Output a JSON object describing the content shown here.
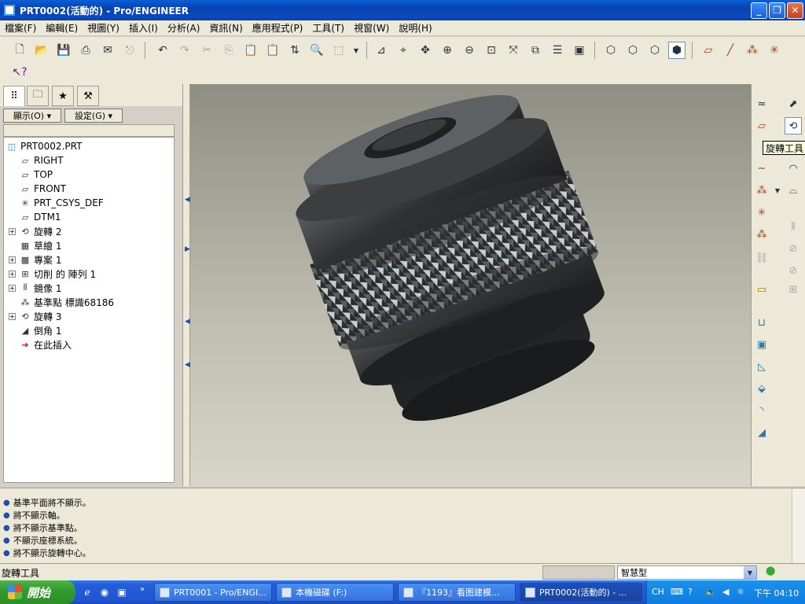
{
  "window": {
    "title": "PRT0002(活動的) - Pro/ENGINEER"
  },
  "menu": [
    "檔案(F)",
    "編輯(E)",
    "視圖(Y)",
    "插入(I)",
    "分析(A)",
    "資訊(N)",
    "應用程式(P)",
    "工具(T)",
    "視窗(W)",
    "說明(H)"
  ],
  "left_panel": {
    "show_button": "顯示(O) ▾",
    "settings_button": "設定(G) ▾",
    "tree": [
      {
        "label": "PRT0002.PRT",
        "icon": "part-icon",
        "glyph": "◫",
        "expand": false,
        "indent": 0
      },
      {
        "label": "RIGHT",
        "icon": "datum-plane-icon",
        "glyph": "▱",
        "expand": false,
        "indent": 1
      },
      {
        "label": "TOP",
        "icon": "datum-plane-icon",
        "glyph": "▱",
        "expand": false,
        "indent": 1
      },
      {
        "label": "FRONT",
        "icon": "datum-plane-icon",
        "glyph": "▱",
        "expand": false,
        "indent": 1
      },
      {
        "label": "PRT_CSYS_DEF",
        "icon": "csys-icon",
        "glyph": "✳",
        "expand": false,
        "indent": 1
      },
      {
        "label": "DTM1",
        "icon": "datum-plane-icon",
        "glyph": "▱",
        "expand": false,
        "indent": 1
      },
      {
        "label": "旋轉 2",
        "icon": "revolve-icon",
        "glyph": "⟲",
        "expand": true,
        "indent": 1
      },
      {
        "label": "草繪 1",
        "icon": "sketch-icon",
        "glyph": "▦",
        "expand": false,
        "indent": 1
      },
      {
        "label": "專案 1",
        "icon": "project-icon",
        "glyph": "▩",
        "expand": true,
        "indent": 1
      },
      {
        "label": "切削 的 陣列 1",
        "icon": "pattern-icon",
        "glyph": "⊞",
        "expand": true,
        "indent": 1
      },
      {
        "label": "鏡像 1",
        "icon": "mirror-icon",
        "glyph": "⫴",
        "expand": true,
        "indent": 1
      },
      {
        "label": "基準點 標識68186",
        "icon": "datum-point-icon",
        "glyph": "⁂",
        "expand": false,
        "indent": 1
      },
      {
        "label": "旋轉 3",
        "icon": "revolve-icon",
        "glyph": "⟲",
        "expand": true,
        "indent": 1
      },
      {
        "label": "倒角 1",
        "icon": "chamfer-icon",
        "glyph": "◢",
        "expand": false,
        "indent": 1
      },
      {
        "label": "在此插入",
        "icon": "insert-here-icon",
        "glyph": "➜",
        "expand": false,
        "indent": 1
      }
    ]
  },
  "tooltip": "旋轉工具",
  "messages": [
    "基準平面將不顯示。",
    "將不顯示軸。",
    "將不顯示基準點。",
    "不顯示座標系統。",
    "將不顯示旋轉中心。"
  ],
  "status": {
    "text": "旋轉工具",
    "filter": "智慧型"
  },
  "taskbar": {
    "start": "開始",
    "tasks": [
      "PRT0001 - Pro/ENGI...",
      "本機磁碟 (F:)",
      "『1193』看图建模...",
      "PRT0002(活動的) - ..."
    ],
    "tray_lang": "CH",
    "clock": "下午 04:10"
  },
  "colors": {
    "titlebar": "#0842b0",
    "viewport_top": "#8e8e84",
    "viewport_bottom": "#d8d6c8",
    "taskbar": "#245edb",
    "start": "#329b2e"
  }
}
